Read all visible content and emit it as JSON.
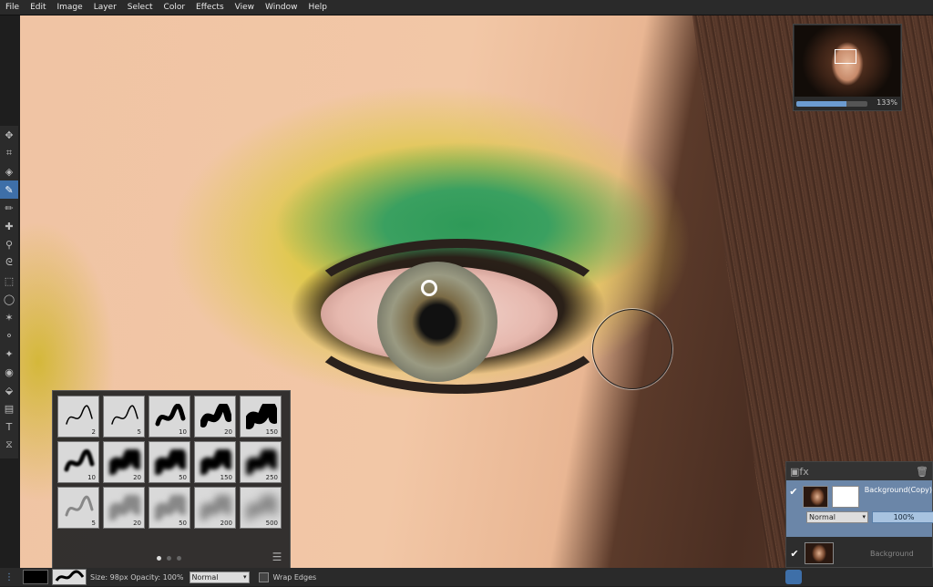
{
  "menu": [
    "File",
    "Edit",
    "Image",
    "Layer",
    "Select",
    "Color",
    "Effects",
    "View",
    "Window",
    "Help"
  ],
  "tools": [
    {
      "icon": "move-icon",
      "glyph": "✥"
    },
    {
      "icon": "crop-icon",
      "glyph": "⌗"
    },
    {
      "icon": "stamp-icon",
      "glyph": "◈"
    },
    {
      "icon": "brush-icon",
      "glyph": "✎",
      "active": true
    },
    {
      "icon": "pencil-icon",
      "glyph": "✏"
    },
    {
      "icon": "clone-icon",
      "glyph": "✚"
    },
    {
      "icon": "eyedropper-icon",
      "glyph": "⚲"
    },
    {
      "icon": "lasso-icon",
      "glyph": "ᘓ"
    },
    {
      "icon": "rect-select-icon",
      "glyph": "⬚"
    },
    {
      "icon": "ellipse-select-icon",
      "glyph": "◯"
    },
    {
      "icon": "magic-wand-icon",
      "glyph": "✶"
    },
    {
      "icon": "dodge-icon",
      "glyph": "⚬"
    },
    {
      "icon": "burn-icon",
      "glyph": "✦"
    },
    {
      "icon": "redeye-icon",
      "glyph": "◉"
    },
    {
      "icon": "bucket-icon",
      "glyph": "⬙"
    },
    {
      "icon": "gradient-icon",
      "glyph": "▤"
    },
    {
      "icon": "text-icon",
      "glyph": "T"
    },
    {
      "icon": "shapes-icon",
      "glyph": "⧖"
    }
  ],
  "navigator": {
    "zoom": "133%",
    "zoom_fill_pct": 70
  },
  "brushes": [
    {
      "size": "2",
      "style": "thin",
      "blur": 0
    },
    {
      "size": "5",
      "style": "thin",
      "blur": 0
    },
    {
      "size": "10",
      "style": "medium",
      "blur": 0
    },
    {
      "size": "20",
      "style": "thick",
      "blur": 0
    },
    {
      "size": "150",
      "style": "blob",
      "blur": 0
    },
    {
      "size": "10",
      "style": "medium",
      "blur": 1
    },
    {
      "size": "20",
      "style": "blob",
      "blur": 2
    },
    {
      "size": "50",
      "style": "blob",
      "blur": 2
    },
    {
      "size": "150",
      "style": "blob",
      "blur": 2
    },
    {
      "size": "250",
      "style": "blob",
      "blur": 3
    },
    {
      "size": "5",
      "style": "gray-thin",
      "blur": 0
    },
    {
      "size": "20",
      "style": "gray-blob",
      "blur": 3
    },
    {
      "size": "50",
      "style": "gray-blob",
      "blur": 3
    },
    {
      "size": "200",
      "style": "gray-blob",
      "blur": 4
    },
    {
      "size": "500",
      "style": "gray-blob",
      "blur": 5
    }
  ],
  "layers": [
    {
      "name": "Background(Copy)",
      "visible": true,
      "selected": true,
      "has_mask": true
    },
    {
      "name": "Background",
      "visible": true,
      "selected": false,
      "has_mask": false
    }
  ],
  "layer_blend": {
    "mode": "Normal",
    "opacity": "100%"
  },
  "status": {
    "brush_info": "Size: 98px  Opacity: 100%",
    "blend_mode": "Normal",
    "wrap_edges": "Wrap Edges"
  }
}
